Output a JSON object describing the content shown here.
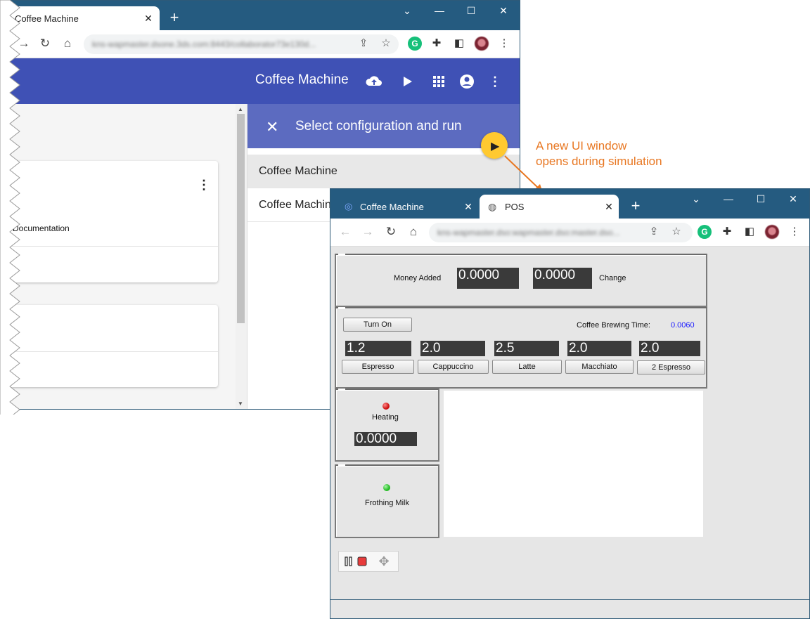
{
  "back_window": {
    "tab_title": "Coffee Machine",
    "tab_close": "✕",
    "new_tab": "+",
    "url": "kns-wapmaster.dsone.3ds.com:8443/collaborator73e130d...",
    "app_title": "Coffee Machine",
    "card_label": "Documentation",
    "panel_title": "Select configuration and run",
    "configurations": [
      "Coffee Machine",
      "Coffee Machine"
    ]
  },
  "annotation": {
    "line1": "A new UI window",
    "line2": "opens during simulation"
  },
  "front_window": {
    "tabs": [
      {
        "label": "Coffee Machine",
        "close": "✕"
      },
      {
        "label": "POS",
        "close": "✕"
      }
    ],
    "new_tab": "+",
    "url": "kns-wapmaster.dso:wapmaster.dso:master.dso...",
    "pos": {
      "money_added_label": "Money Added",
      "money_added_value": "0.0000",
      "change_value": "0.0000",
      "change_label": "Change",
      "turn_on_label": "Turn On",
      "brewing_time_label": "Coffee Brewing Time:",
      "brewing_time_value": "0.0060",
      "prices": [
        "1.2",
        "2.0",
        "2.5",
        "2.0",
        "2.0"
      ],
      "drinks": [
        "Espresso",
        "Cappuccino",
        "Latte",
        "Macchiato",
        "2 Espresso"
      ],
      "heating_label": "Heating",
      "heating_value": "0.0000",
      "frothing_label": "Frothing Milk",
      "colors": {
        "heating_led": "#cc1111",
        "frothing_led": "#22bb22"
      }
    }
  }
}
